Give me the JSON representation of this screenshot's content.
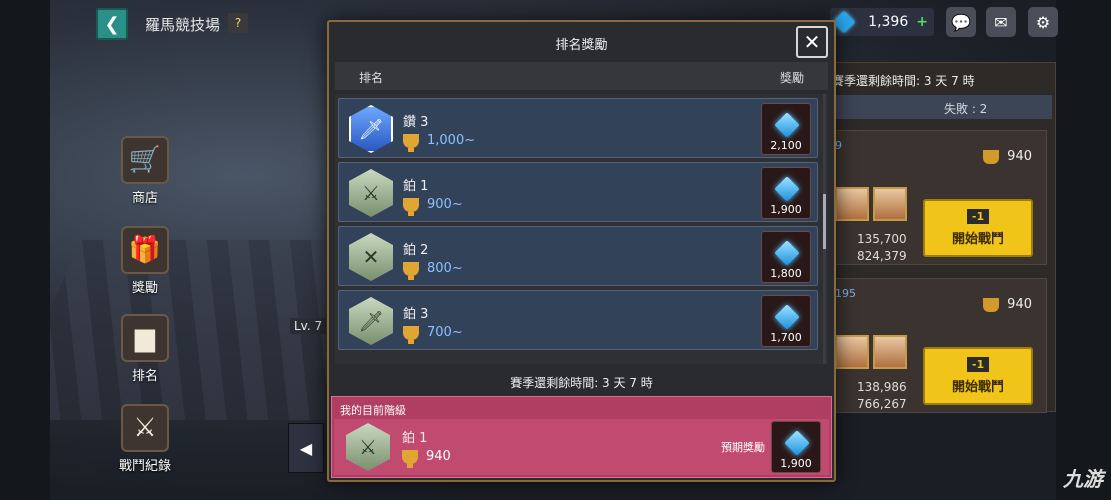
{
  "topbar": {
    "title": "羅馬競技場",
    "help": "?",
    "gems": "1,396",
    "plus": "+"
  },
  "side_menu": [
    {
      "label": "商店",
      "icon": "shop-cart-icon",
      "glyph": "🛒"
    },
    {
      "label": "獎勵",
      "icon": "gift-icon",
      "glyph": "🎁"
    },
    {
      "label": "排名",
      "icon": "podium-icon",
      "glyph": "▆"
    },
    {
      "label": "戰鬥紀錄",
      "icon": "battle-log-icon",
      "glyph": "⚔"
    }
  ],
  "player_level": "Lv. 7",
  "background_panel": {
    "season_text": "賽季還剩餘時間: 3 天 7 時",
    "lose_text": "失敗 : 2",
    "opponents": [
      {
        "rank_tag": "9",
        "trophies": "940",
        "power": "135,700",
        "total": "824,379",
        "cost": "-1",
        "button": "開始戰鬥"
      },
      {
        "rank_tag": "195",
        "trophies": "940",
        "power": "138,986",
        "total": "766,267",
        "cost": "-1",
        "button": "開始戰鬥"
      }
    ]
  },
  "modal": {
    "title": "排名獎勵",
    "col_rank": "排名",
    "col_reward": "獎勵",
    "rows": [
      {
        "tier": "鑽 3",
        "score": "1,000~",
        "reward": "2,100",
        "medal": "diamond"
      },
      {
        "tier": "鉑 1",
        "score": "900~",
        "reward": "1,900",
        "medal": "plat"
      },
      {
        "tier": "鉑 2",
        "score": "800~",
        "reward": "1,800",
        "medal": "plat"
      },
      {
        "tier": "鉑 3",
        "score": "700~",
        "reward": "1,700",
        "medal": "plat"
      }
    ],
    "season_text": "賽季還剩餘時間: 3 天 7 時",
    "my_rank": {
      "label": "我的目前階級",
      "tier": "鉑 1",
      "score": "940",
      "expected_label": "預期獎勵",
      "reward": "1,900"
    }
  },
  "watermark": "九游",
  "colors": {
    "accent_gold": "#f0c419",
    "my_rank_bg": "#b03e62",
    "row_bg": "#324359",
    "score_blue": "#8fbfff"
  }
}
